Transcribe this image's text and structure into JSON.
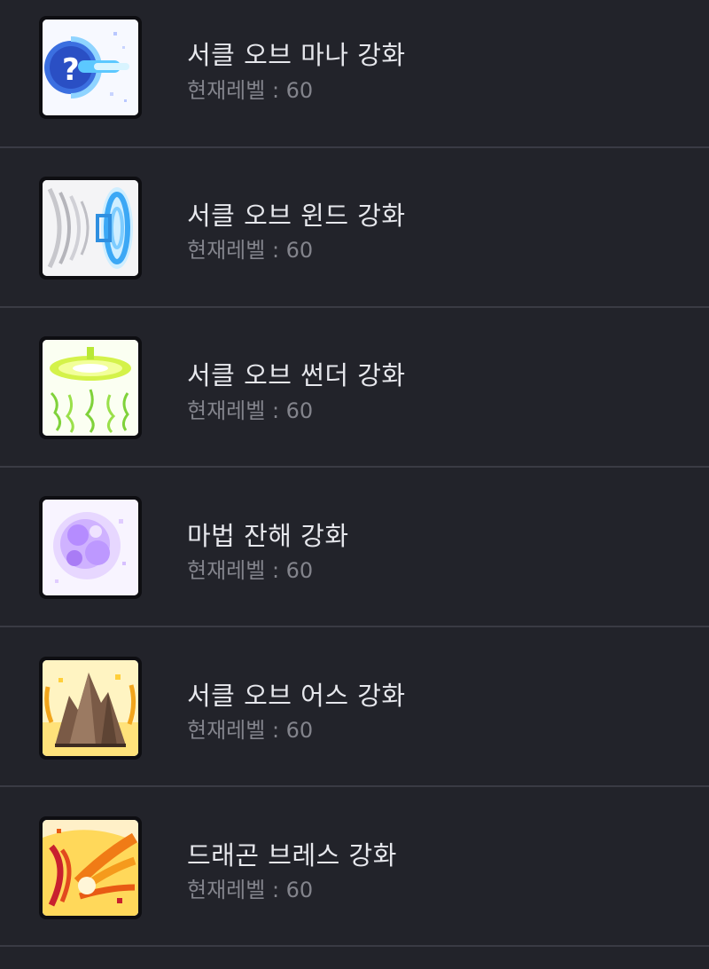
{
  "skills": [
    {
      "name": "서클 오브 마나 강화",
      "level_text": "현재레벨 : 60",
      "icon": "circle-of-mana-icon"
    },
    {
      "name": "서클 오브 윈드 강화",
      "level_text": "현재레벨 : 60",
      "icon": "circle-of-wind-icon"
    },
    {
      "name": "서클 오브 썬더 강화",
      "level_text": "현재레벨 : 60",
      "icon": "circle-of-thunder-icon"
    },
    {
      "name": "마법 잔해 강화",
      "level_text": "현재레벨 : 60",
      "icon": "magic-debris-icon"
    },
    {
      "name": "서클 오브 어스 강화",
      "level_text": "현재레벨 : 60",
      "icon": "circle-of-earth-icon"
    },
    {
      "name": "드래곤 브레스 강화",
      "level_text": "현재레벨 : 60",
      "icon": "dragon-breath-icon"
    }
  ],
  "colors": {
    "background": "#22232a",
    "divider": "#3a3b44",
    "title": "#e6e7ec",
    "subtitle": "#83848c"
  }
}
